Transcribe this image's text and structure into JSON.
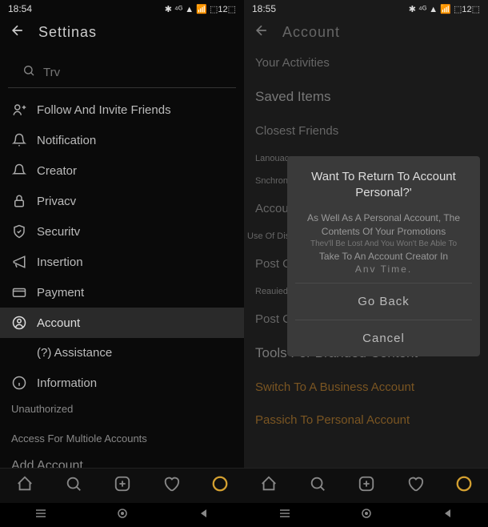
{
  "left": {
    "status": {
      "time": "18:54",
      "icons_left": "⬇ ◧ ⬇",
      "icons_right": "✱ ⁴ᴳ ▲ 📶 ⬚12⬚"
    },
    "header": {
      "title": "Settinas"
    },
    "search": {
      "placeholder": "Trv"
    },
    "items": [
      {
        "icon": "person-plus",
        "label": "Follow And Invite Friends"
      },
      {
        "icon": "bell",
        "label": "Notification"
      },
      {
        "icon": "bell",
        "label": "Creator"
      },
      {
        "icon": "lock",
        "label": "Privacv"
      },
      {
        "icon": "shield",
        "label": "Securitv"
      },
      {
        "icon": "megaphone",
        "label": "Insertion"
      },
      {
        "icon": "card",
        "label": "Payment"
      },
      {
        "icon": "account",
        "label": "Account"
      },
      {
        "icon": "help",
        "label": "(?) Assistance"
      },
      {
        "icon": "info",
        "label": "Information"
      }
    ],
    "sub1": "Unauthorized",
    "sub2": "Access For Multiole Accounts",
    "add": "Add Account"
  },
  "right": {
    "status": {
      "time": "18:55",
      "icons_left": "⬇ ◧ ⬇",
      "icons_right": "✱ ⁴ᴳ ▲ 📶 ⬚12⬚"
    },
    "header": {
      "title": "Account"
    },
    "items": [
      "Your Activities",
      "Saved Items",
      "Closest Friends",
      "Lanouace",
      "Snchronous",
      "Accour",
      "Use Of Displavina Statistical Data. You Can",
      "Post Or",
      "Reauied",
      "Post Ch",
      "Tools For Branded Content",
      "Switch To A Business Account",
      "Passich To Personal Account"
    ],
    "modal": {
      "title": "Want To Return To Account Personal?'",
      "body1": "As Well As A Personal Account, The Contents Of Your Promotions",
      "body2": "Thev'll Be Lost And You Won't Be Able To",
      "body3": "Take To An Account Creator In",
      "body4": "Anv Time.",
      "btn1": "Go Back",
      "btn2": "Cancel"
    }
  },
  "nav": [
    "home",
    "search",
    "add",
    "heart",
    "profile"
  ]
}
